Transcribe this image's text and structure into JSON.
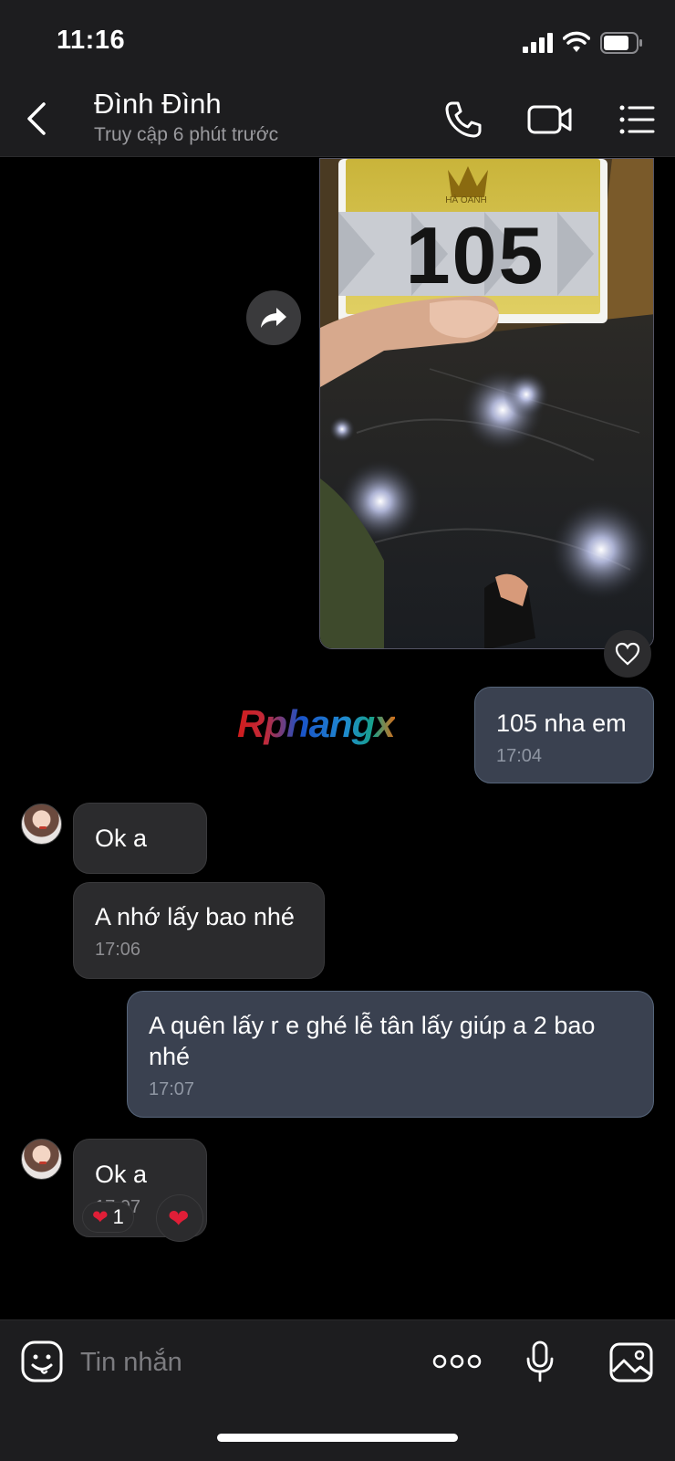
{
  "status_bar": {
    "time": "11:16"
  },
  "header": {
    "contact_name": "Đình Đình",
    "contact_status": "Truy cập 6 phút trước"
  },
  "photo_message": {
    "label_number": "105",
    "label_brand": "HÀ OANH"
  },
  "watermark": {
    "text": "Rphangx"
  },
  "messages": [
    {
      "direction": "out",
      "text": "105 nha em",
      "time": "17:04"
    },
    {
      "direction": "in",
      "text": "Ok a",
      "time": ""
    },
    {
      "direction": "in",
      "text": "A nhớ lấy bao nhé",
      "time": "17:06"
    },
    {
      "direction": "out",
      "text": "A quên lấy r e ghé lễ tân lấy giúp a 2 bao nhé",
      "time": "17:07"
    },
    {
      "direction": "in",
      "text": "Ok a",
      "time": "17:07"
    }
  ],
  "reactions": {
    "heart_icon": "❤",
    "count": "1",
    "add_icon": "❤"
  },
  "input_bar": {
    "placeholder": "Tin nhắn"
  },
  "icons": {
    "back": "chevron-left-icon",
    "call": "phone-icon",
    "video": "video-icon",
    "menu": "list-icon",
    "share": "share-arrow-icon",
    "like": "heart-outline-icon",
    "emoji": "smiley-icon",
    "more": "more-dots-icon",
    "mic": "microphone-icon",
    "image": "image-icon"
  },
  "colors": {
    "outgoing_bubble": "#3a4150",
    "incoming_bubble": "#2b2b2d",
    "reaction_heart": "#e01e37"
  }
}
